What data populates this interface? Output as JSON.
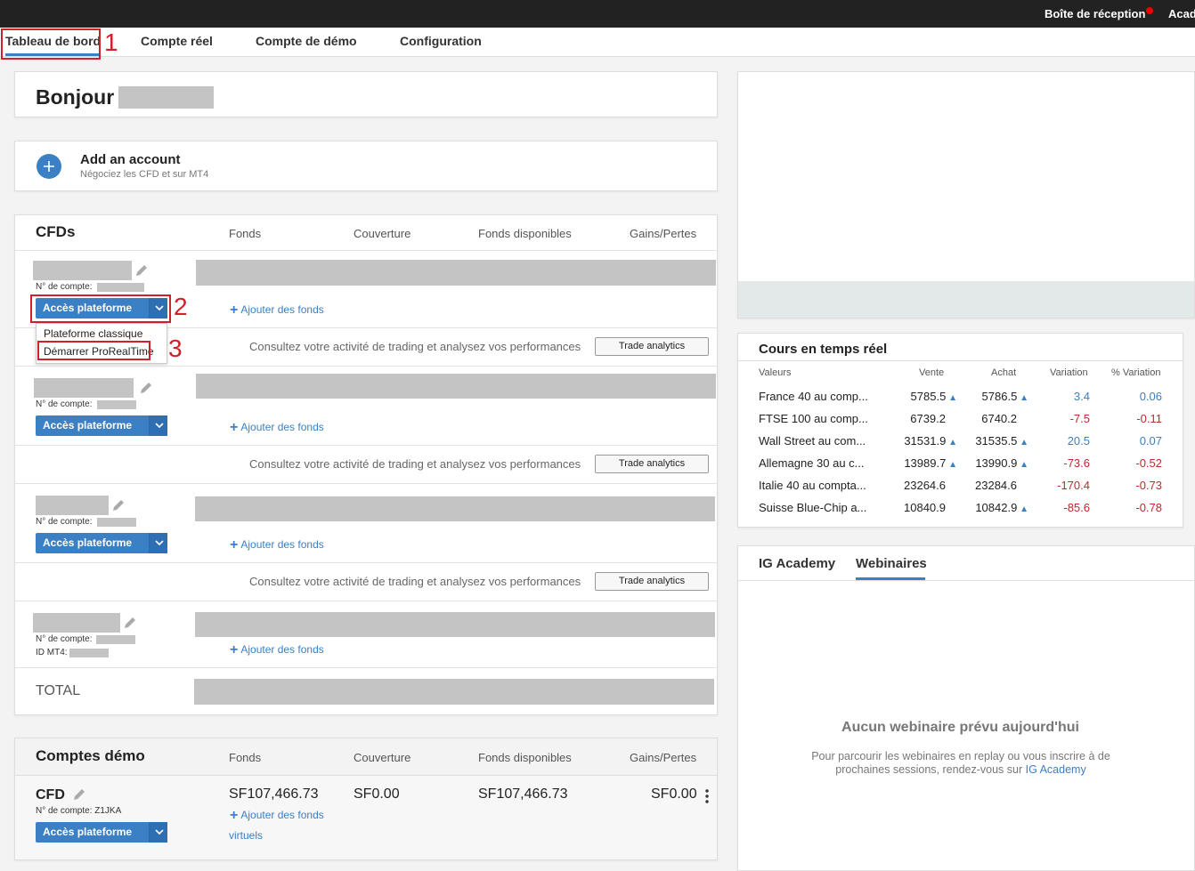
{
  "topbar": {
    "inbox_label": "Boîte de réception",
    "academy_label": "Acad"
  },
  "nav": {
    "tabs": [
      {
        "label": "Tableau de bord",
        "active": true
      },
      {
        "label": "Compte réel"
      },
      {
        "label": "Compte de démo"
      },
      {
        "label": "Configuration"
      }
    ]
  },
  "annotations": {
    "n1": "1",
    "n2": "2",
    "n3": "3"
  },
  "greeting": {
    "text": "Bonjour"
  },
  "add_account": {
    "title": "Add an account",
    "subtitle": "Négociez les CFD et sur MT4"
  },
  "cfds": {
    "title": "CFDs",
    "columns": [
      "Fonds",
      "Couverture",
      "Fonds disponibles",
      "Gains/Pertes"
    ],
    "account_number_label": "N° de compte:",
    "mt4_label": "ID MT4:",
    "platform_button": "Accès plateforme",
    "add_funds": "Ajouter des fonds",
    "analytics_text": "Consultez votre activité de trading et analysez vos performances",
    "analytics_button": "Trade analytics",
    "dropdown": {
      "items": [
        "Plateforme classique",
        "Démarrer ProRealTime"
      ]
    },
    "total_label": "TOTAL"
  },
  "demo": {
    "title": "Comptes démo",
    "columns": [
      "Fonds",
      "Couverture",
      "Fonds disponibles",
      "Gains/Pertes"
    ],
    "account": {
      "name": "CFD",
      "account_number": "N° de compte: Z1JKA",
      "funds": "SF107,466.73",
      "cover": "SF0.00",
      "available": "SF107,466.73",
      "pnl": "SF0.00",
      "add_funds": "Ajouter des fonds",
      "add_funds_suffix": "virtuels",
      "platform_button": "Accès plateforme"
    }
  },
  "quotes": {
    "title": "Cours en temps réel",
    "columns": [
      "Valeurs",
      "Vente",
      "Achat",
      "Variation",
      "% Variation"
    ],
    "rows": [
      {
        "name": "France 40 au comp...",
        "sell": "5785.5",
        "sell_up": true,
        "buy": "5786.5",
        "buy_up": true,
        "change": "3.4",
        "pct": "0.06",
        "positive": true
      },
      {
        "name": "FTSE 100 au comp...",
        "sell": "6739.2",
        "sell_up": false,
        "buy": "6740.2",
        "buy_up": false,
        "change": "-7.5",
        "pct": "-0.11",
        "positive": false
      },
      {
        "name": "Wall Street au com...",
        "sell": "31531.9",
        "sell_up": true,
        "buy": "31535.5",
        "buy_up": true,
        "change": "20.5",
        "pct": "0.07",
        "positive": true
      },
      {
        "name": "Allemagne 30 au c...",
        "sell": "13989.7",
        "sell_up": true,
        "buy": "13990.9",
        "buy_up": true,
        "change": "-73.6",
        "pct": "-0.52",
        "positive": false
      },
      {
        "name": "Italie 40 au compta...",
        "sell": "23264.6",
        "sell_up": false,
        "buy": "23284.6",
        "buy_up": false,
        "change": "-170.4",
        "pct": "-0.73",
        "positive": false
      },
      {
        "name": "Suisse Blue-Chip a...",
        "sell": "10840.9",
        "sell_up": false,
        "buy": "10842.9",
        "buy_up": true,
        "change": "-85.6",
        "pct": "-0.78",
        "positive": false
      }
    ]
  },
  "academy": {
    "tabs": [
      "IG Academy",
      "Webinaires"
    ],
    "empty_title": "Aucun webinaire prévu aujourd'hui",
    "empty_text_1": "Pour parcourir les webinaires en replay ou vous inscrire à de",
    "empty_text_2": "prochaines sessions, rendez-vous sur",
    "empty_link": "IG Academy"
  },
  "colors": {
    "accent": "#3b7fc4",
    "negative": "#c0282d",
    "annotation": "#d0202a",
    "topbar": "#222222"
  }
}
